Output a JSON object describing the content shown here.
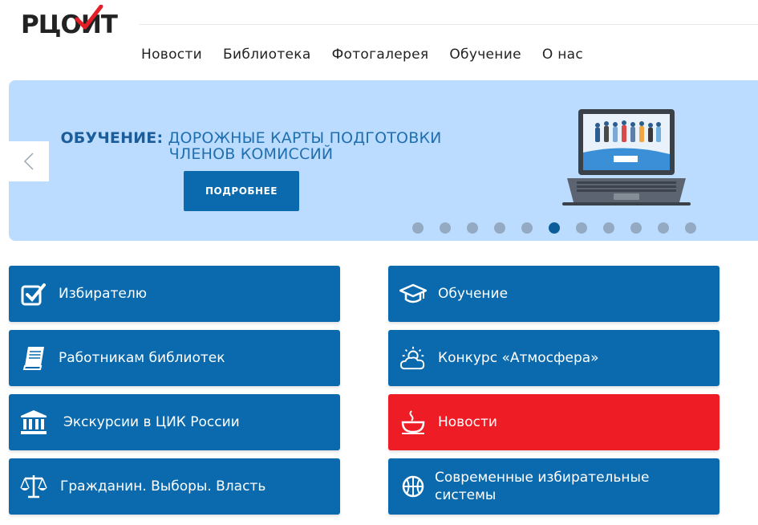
{
  "logo": {
    "text": "РЦОИТ"
  },
  "nav": {
    "items": [
      "Новости",
      "Библиотека",
      "Фотогалерея",
      "Обучение",
      "О нас"
    ]
  },
  "slider": {
    "title_bold": "ОБУЧЕНИЕ:",
    "title_rest": " ДОРОЖНЫЕ КАРТЫ ПОДГОТОВКИ ЧЛЕНОВ КОМИССИЙ",
    "button_label": "ПОДРОБНЕЕ",
    "dot_count": 11,
    "active_dot": 5
  },
  "tiles": {
    "left": [
      {
        "label": "Избирателю",
        "icon": "checkbox-icon"
      },
      {
        "label": "Работникам библиотек",
        "icon": "book-icon"
      },
      {
        "label": "Экскурсии в ЦИК России",
        "icon": "building-icon"
      },
      {
        "label": "Гражданин. Выборы. Власть",
        "icon": "scales-icon"
      }
    ],
    "right": [
      {
        "label": "Обучение",
        "icon": "graduation-cap-icon"
      },
      {
        "label": "Конкурс «Атмосфера»",
        "icon": "sun-cloud-icon"
      },
      {
        "label": "Новости",
        "icon": "coffee-cup-icon"
      },
      {
        "label": "Современные избирательные системы",
        "icon": "basketball-icon"
      }
    ]
  },
  "colors": {
    "tile_blue": "#0a6aad",
    "tile_red": "#ee1c25",
    "slider_bg": "#bcdcff",
    "logo_accent": "#e41e26"
  }
}
